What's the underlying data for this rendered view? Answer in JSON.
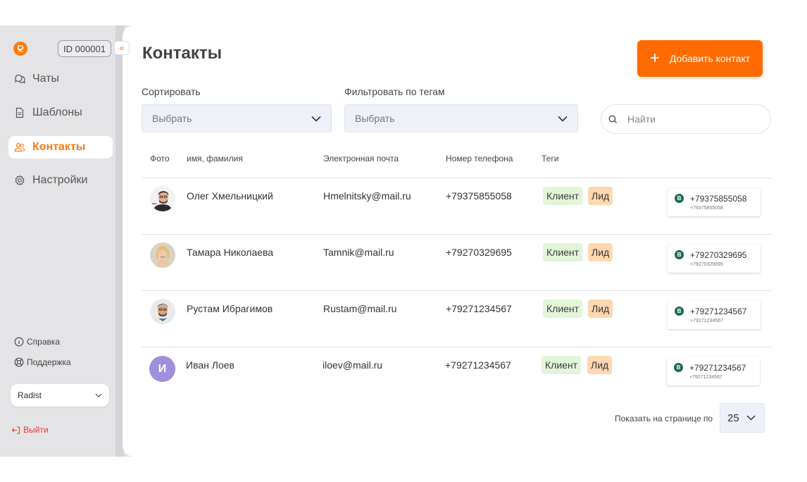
{
  "sidebar": {
    "account_id": "ID 000001",
    "collapse_glyph": "«",
    "nav": [
      {
        "label": "Чаты",
        "icon": "chats-icon"
      },
      {
        "label": "Шаблоны",
        "icon": "templates-icon"
      },
      {
        "label": "Контакты",
        "icon": "contacts-icon",
        "active": true
      },
      {
        "label": "Настройки",
        "icon": "settings-icon"
      }
    ],
    "help_label": "Справка",
    "support_label": "Поддержка",
    "workspace": "Radist",
    "logout_label": "Выйти"
  },
  "header": {
    "title": "Контакты",
    "add_button_label": "Добавить контакт"
  },
  "filters": {
    "sort_label": "Сортировать",
    "sort_value": "Выбрать",
    "tags_label": "Фильтровать по тегам",
    "tags_value": "Выбрать",
    "search_placeholder": "Найти"
  },
  "table": {
    "columns": [
      "Фото",
      "имя, фамилия",
      "Электронная почта",
      "Номер телефона",
      "Теги"
    ],
    "rows": [
      {
        "name": "Олег Хмельницкий",
        "email": "Hmelnitsky@mail.ru",
        "phone": "+79375855058",
        "tags": [
          "Клиент",
          "Лид"
        ],
        "channel_phone": "+79375855058",
        "channel_sub": "+79375855058",
        "avatar": "photo"
      },
      {
        "name": "Тамара Николаева",
        "email": "Tamnik@mail.ru",
        "phone": "+79270329695",
        "tags": [
          "Клиент",
          "Лид"
        ],
        "channel_phone": "+79270329695",
        "channel_sub": "+79270329695",
        "avatar": "photo"
      },
      {
        "name": "Рустам Ибрагимов",
        "email": "Rustam@mail.ru",
        "phone": "+79271234567",
        "tags": [
          "Клиент",
          "Лид"
        ],
        "channel_phone": "+79271234567",
        "channel_sub": "+79271234567",
        "avatar": "photo"
      },
      {
        "name": "Иван Лоев",
        "email": "iloev@mail.ru",
        "phone": "+79271234567",
        "tags": [
          "Клиент",
          "Лид"
        ],
        "channel_phone": "+79271234567",
        "channel_sub": "+79271234567",
        "avatar": "initial",
        "initial": "И"
      }
    ]
  },
  "pagination": {
    "per_page_label": "Показать на странице по",
    "per_page_value": "25"
  },
  "colors": {
    "accent": "#ff6b00",
    "tag_client": "#e3f5d8",
    "tag_lead": "#ffd7b0",
    "whatsapp": "#1e6b50"
  }
}
